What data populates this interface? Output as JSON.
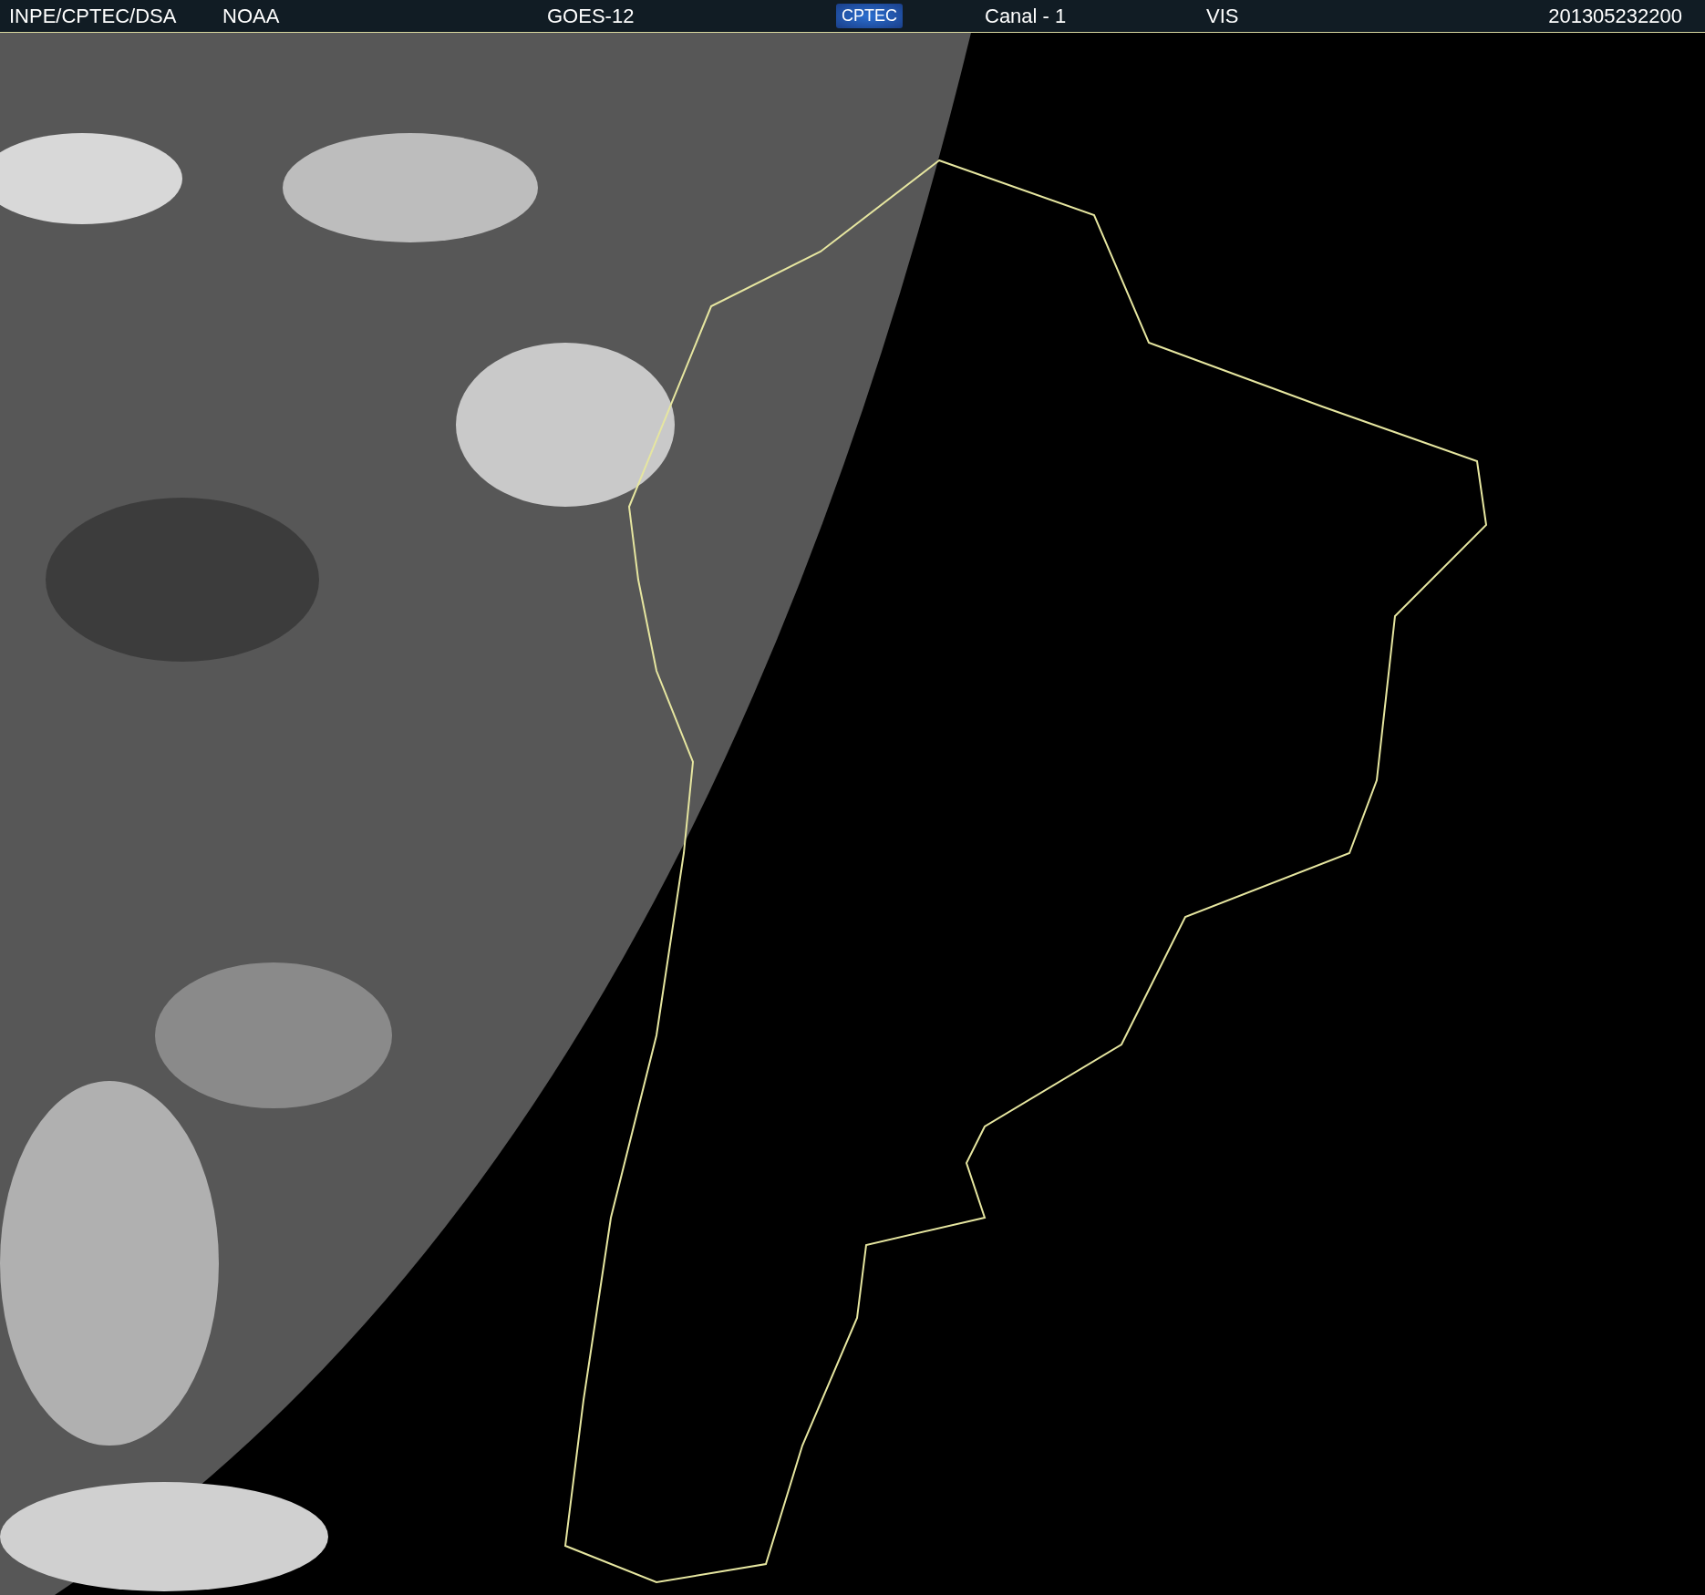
{
  "header": {
    "items": [
      {
        "kind": "text",
        "text": "INPE/CPTEC/DSA"
      },
      {
        "kind": "text",
        "text": "NOAA"
      },
      {
        "kind": "text",
        "text": "GOES-12"
      },
      {
        "kind": "logo",
        "text": "CPTEC"
      },
      {
        "kind": "text",
        "text": "Canal - 1"
      },
      {
        "kind": "text",
        "text": "VIS"
      },
      {
        "kind": "text",
        "text": "201305232200"
      }
    ]
  }
}
